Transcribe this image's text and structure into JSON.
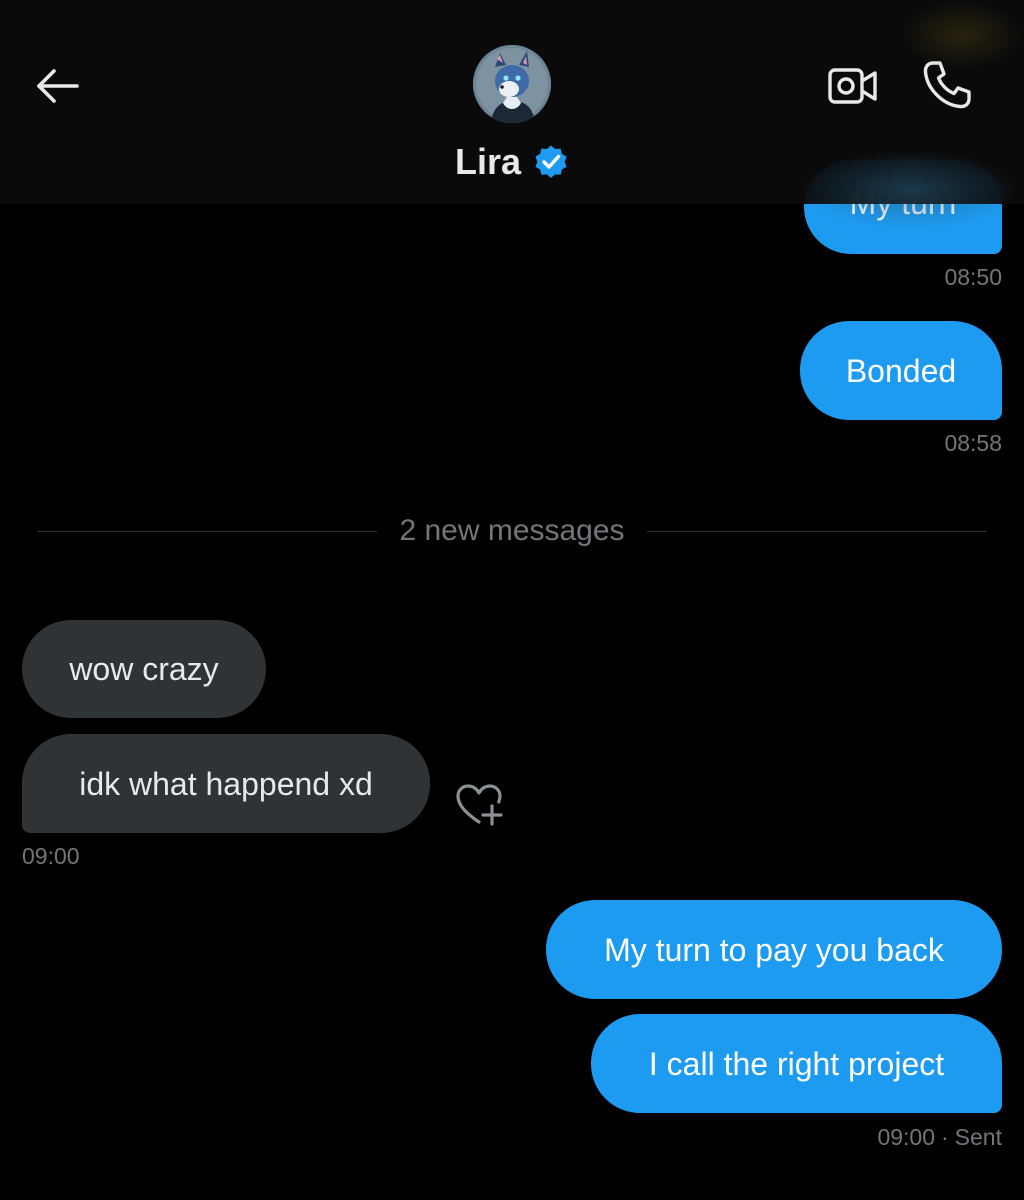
{
  "header": {
    "contact_name": "Lira",
    "back_icon": "arrow-left-icon",
    "video_icon": "video-camera-icon",
    "call_icon": "phone-icon",
    "verified_icon": "verified-badge-icon",
    "verified_color": "#1d9bf0"
  },
  "messages": [
    {
      "direction": "sent",
      "text": "My turn",
      "time": "08:50"
    },
    {
      "direction": "sent",
      "text": "Bonded",
      "time": "08:58"
    },
    {
      "direction": "received",
      "text": "wow crazy"
    },
    {
      "direction": "received",
      "text": "idk what happend xd",
      "time": "09:00"
    },
    {
      "direction": "sent",
      "text": "My turn to pay you back"
    },
    {
      "direction": "sent",
      "text": "I call the right project",
      "time": "09:00",
      "status": "Sent"
    }
  ],
  "divider": {
    "label": "2 new messages"
  },
  "colors": {
    "background": "#000000",
    "sent_bubble": "#1d9bf0",
    "received_bubble": "#2f3336",
    "muted_text": "#71767b"
  }
}
